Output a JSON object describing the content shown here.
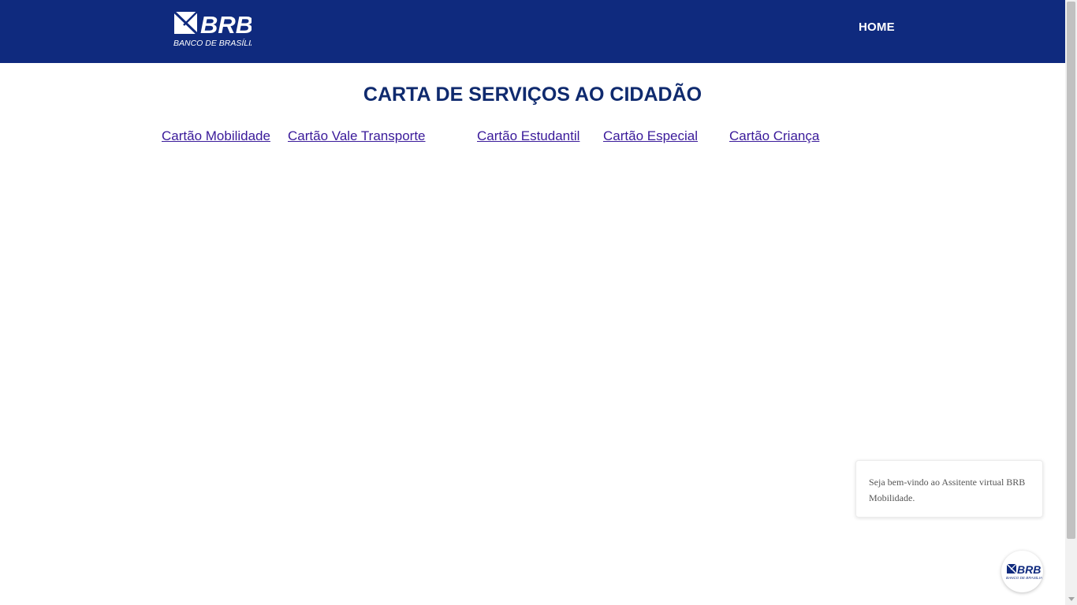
{
  "header": {
    "logo": {
      "icon": "brb-logo-icon",
      "brand": "BRB",
      "subtitle": "BANCO DE BRASÍLIA"
    },
    "nav": {
      "home_label": "HOME"
    }
  },
  "main": {
    "title": "CARTA DE SERVIÇOS AO CIDADÃO",
    "links": [
      {
        "label": "Cartão Mobilidade"
      },
      {
        "label": "Cartão Vale Transporte"
      },
      {
        "label": "Cartão Estudantil"
      },
      {
        "label": "Cartão Especial"
      },
      {
        "label": "Cartão Criança"
      }
    ]
  },
  "chat": {
    "welcome_message": "Seja bem-vindo ao Assitente virtual BRB Mobilidade.",
    "launcher_icon": "brb-chat-avatar-icon"
  },
  "colors": {
    "header_bg": "#0f2a7e",
    "title": "#0f2a6e",
    "link": "#3a1a9a"
  }
}
